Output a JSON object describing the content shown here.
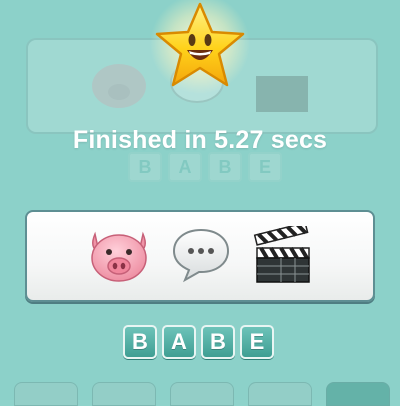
{
  "result": {
    "message": "Finished in 5.27 secs"
  },
  "clue": {
    "emoji_icons": [
      "pig-face-icon",
      "speech-bubble-icon",
      "clapperboard-icon"
    ]
  },
  "answer": {
    "letters": [
      "B",
      "A",
      "B",
      "E"
    ]
  },
  "ghost_answer": {
    "letters": [
      "B",
      "A",
      "B",
      "E"
    ]
  },
  "colors": {
    "background": "#8cd1c9",
    "tile": "#4fae a3",
    "star": "#ffd21a",
    "text": "#ffffff"
  }
}
